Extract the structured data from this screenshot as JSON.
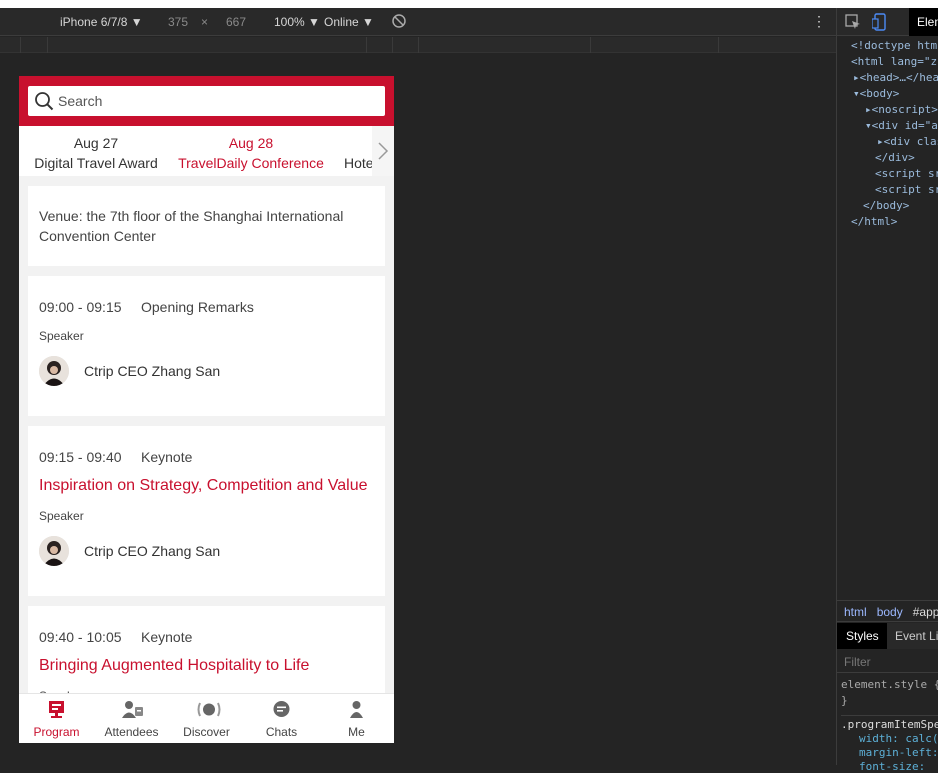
{
  "devtools": {
    "device": "iPhone 6/7/8 ▼",
    "width": "375",
    "times": "×",
    "height": "667",
    "zoom": "100% ▼",
    "network": "Online ▼",
    "more": "⋮",
    "elements_tab": "Elements",
    "code_lines": [
      "<!doctype html>",
      "<html lang=\"zh",
      "▸<head>…</head>",
      "▾<body>",
      "▸<noscript>",
      "▾<div id=\"app",
      "▸<div class",
      "</div>",
      "<script src",
      "<script src",
      "</body>",
      "</html>"
    ],
    "breadcrumb": [
      "html",
      "body",
      "#app"
    ],
    "styles_tab": "Styles",
    "event_tab": "Event Listeners",
    "filter_placeholder": "Filter",
    "style_rules": [
      "element.style {",
      "}",
      ".programItemSpeaker",
      "width: calc(",
      "margin-left:",
      "font-size:"
    ]
  },
  "app": {
    "search": {
      "placeholder": "Search"
    },
    "dates": [
      {
        "date": "Aug 27",
        "event": "Digital Travel Award",
        "active": false
      },
      {
        "date": "Aug 28",
        "event": "TravelDaily Conference",
        "active": true
      },
      {
        "date": "",
        "event": "Hotel",
        "active": false
      }
    ],
    "venue": "Venue: the 7th floor of the Shanghai International Convention Center",
    "sessions": [
      {
        "time": "09:00 - 09:15",
        "type": "Opening Remarks",
        "title": "",
        "speaker_label": "Speaker",
        "speaker": "Ctrip CEO Zhang San"
      },
      {
        "time": "09:15 - 09:40",
        "type": "Keynote",
        "title": "Inspiration on Strategy, Competition and Value",
        "speaker_label": "Speaker",
        "speaker": "Ctrip CEO Zhang San"
      },
      {
        "time": "09:40 - 10:05",
        "type": "Keynote",
        "title": "Bringing Augmented Hospitality to Life",
        "speaker_label": "Speaker",
        "speaker": ""
      }
    ],
    "tabs": [
      {
        "label": "Program",
        "icon": "program-icon",
        "active": true
      },
      {
        "label": "Attendees",
        "icon": "attendees-icon",
        "active": false
      },
      {
        "label": "Discover",
        "icon": "discover-icon",
        "active": false
      },
      {
        "label": "Chats",
        "icon": "chats-icon",
        "active": false
      },
      {
        "label": "Me",
        "icon": "me-icon",
        "active": false
      }
    ],
    "colors": {
      "brand": "#c8102e"
    }
  }
}
